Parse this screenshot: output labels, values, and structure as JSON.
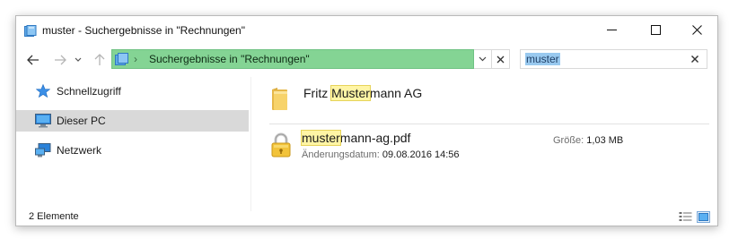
{
  "window": {
    "title": "muster - Suchergebnisse in \"Rechnungen\""
  },
  "address_bar": {
    "location": "Suchergebnisse in \"Rechnungen\"",
    "background_color": "#84d494"
  },
  "search": {
    "value": "muster"
  },
  "nav_pane": {
    "items": [
      {
        "label": "Schnellzugriff",
        "icon": "star-icon",
        "selected": false
      },
      {
        "label": "Dieser PC",
        "icon": "computer-icon",
        "selected": true
      },
      {
        "label": "Netzwerk",
        "icon": "network-icon",
        "selected": false
      }
    ]
  },
  "results": [
    {
      "type": "folder",
      "icon": "folder-icon",
      "name_before": "Fritz ",
      "name_match": "Muster",
      "name_after": "mann AG"
    },
    {
      "type": "file",
      "icon": "lock-icon",
      "name_before": "",
      "name_match": "muster",
      "name_after": "mann-ag.pdf",
      "modified_label": "Änderungsdatum:",
      "modified_value": "09.08.2016 14:56",
      "size_label": "Größe:",
      "size_value": "1,03 MB"
    }
  ],
  "status_bar": {
    "item_count": "2 Elemente"
  },
  "colors": {
    "highlight": "#fff5a5",
    "selection": "#d9d9d9",
    "search_selection": "#99c9ef"
  }
}
